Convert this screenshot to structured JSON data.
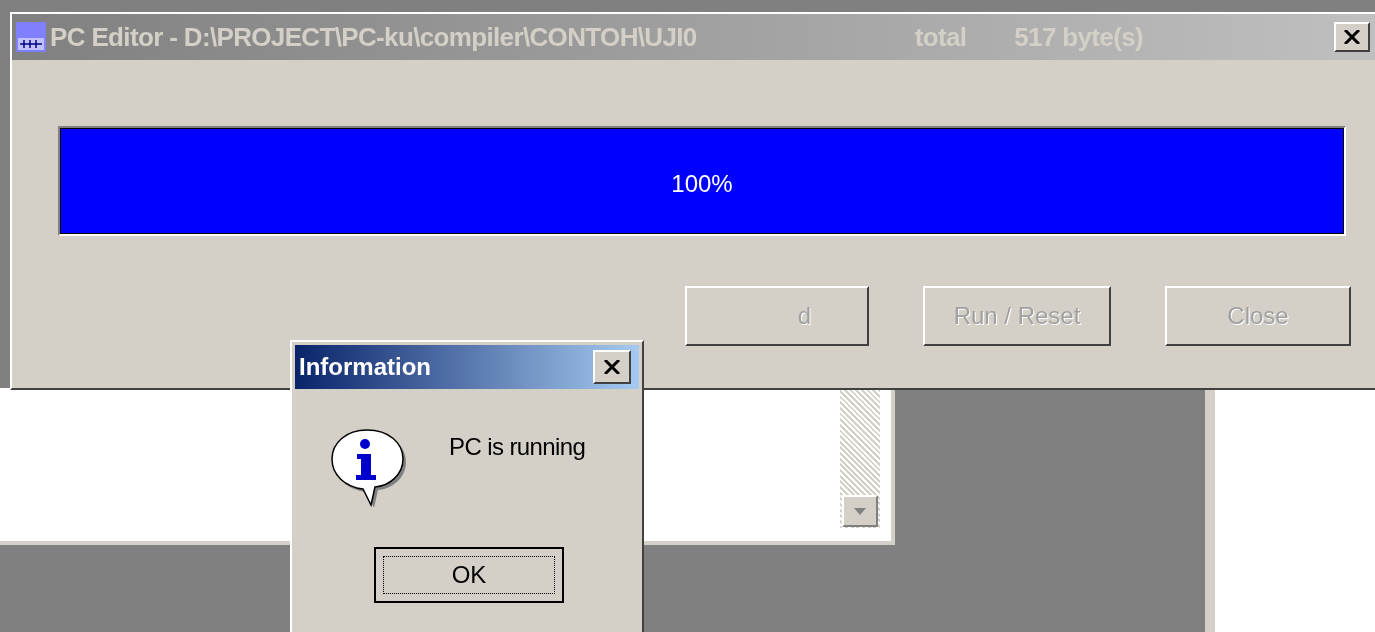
{
  "main_window": {
    "title_parts": [
      "PC Editor - D:\\PROJECT\\PC-ku\\compiler\\CONTOH\\UJI0",
      "total",
      "517 byte(s)"
    ],
    "active": false,
    "progress": {
      "level": 1,
      "reading": "100%"
    },
    "buttons": [
      {
        "label": "d",
        "disabled": true
      },
      {
        "label": "Run / Reset",
        "disabled": true
      },
      {
        "label": "Close",
        "disabled": true
      }
    ]
  },
  "dialog": {
    "title": "Information",
    "message": "PC is running",
    "button": "OK",
    "active": true
  }
}
